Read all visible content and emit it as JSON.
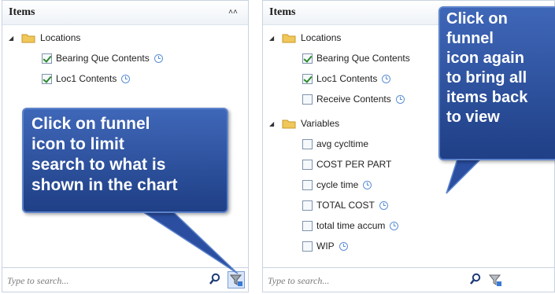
{
  "left_panel": {
    "title": "Items",
    "collapse_glyph": "˄˄",
    "tree": {
      "folder_label": "Locations",
      "items": [
        {
          "label": "Bearing Que Contents",
          "checked": true
        },
        {
          "label": "Loc1 Contents",
          "checked": true
        }
      ]
    },
    "search": {
      "placeholder": "Type to search..."
    },
    "callout_lines": [
      "Click on funnel",
      "icon to limit",
      "search to what is",
      "shown in the chart"
    ]
  },
  "right_panel": {
    "title": "Items",
    "tree": {
      "locations_label": "Locations",
      "locations": [
        {
          "label": "Bearing Que Contents",
          "checked": true
        },
        {
          "label": "Loc1 Contents",
          "checked": true
        },
        {
          "label": "Receive Contents",
          "checked": false
        }
      ],
      "variables_label": "Variables",
      "variables": [
        {
          "label": "avg cycltime",
          "checked": false
        },
        {
          "label": "COST PER PART",
          "checked": false
        },
        {
          "label": "cycle time",
          "checked": false
        },
        {
          "label": "TOTAL COST",
          "checked": false
        },
        {
          "label": "total time accum",
          "checked": false
        },
        {
          "label": "WIP",
          "checked": false
        }
      ]
    },
    "search": {
      "placeholder": "Type to search..."
    },
    "callout_lines": [
      "Click on",
      "funnel",
      "icon again",
      "to bring all",
      "items back",
      "to view"
    ]
  },
  "colors": {
    "accent": "#2b4ea0",
    "folder": "#f0c75a",
    "check": "#2a8a2a",
    "clock": "#5b8fd6"
  }
}
